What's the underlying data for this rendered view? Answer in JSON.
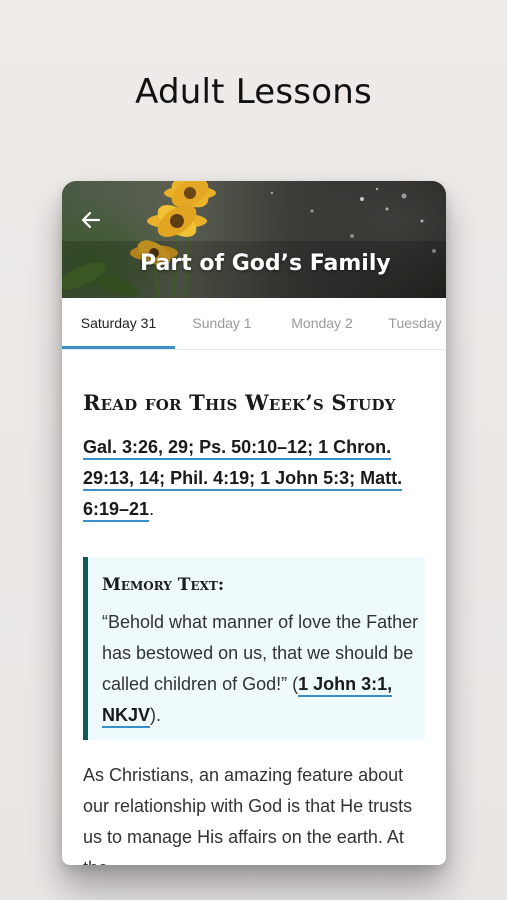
{
  "promo": {
    "title": "Adult Lessons"
  },
  "hero": {
    "title": "Part of God’s Family"
  },
  "tabs": [
    {
      "label": "Saturday 31",
      "active": true
    },
    {
      "label": "Sunday 1",
      "active": false
    },
    {
      "label": "Monday 2",
      "active": false
    },
    {
      "label": "Tuesday",
      "active": false
    }
  ],
  "lesson": {
    "heading": "Read for This Week’s Study",
    "refs": [
      "Gal. 3:26, 29",
      "Ps. 50:10–12",
      "1 Chron. 29:13, 14",
      "Phil. 4:19",
      "1 John 5:3",
      "Matt. 6:19–21"
    ],
    "memory_label": "Memory Text:",
    "memory_text": "“Behold what manner of love the Father has bestowed on us, that we should be called children of God!” (",
    "memory_ref": "1 John 3:1, NKJV",
    "memory_close": ").",
    "body": "As Christians, an amazing feature about our relationship with God is that He trusts us to manage His affairs on the earth. At the"
  },
  "colors": {
    "accent": "#3a8fc7",
    "memory_bar": "#0f5a57",
    "memory_bg": "#eefafb"
  },
  "icons": {
    "back": "arrow-left-icon"
  }
}
